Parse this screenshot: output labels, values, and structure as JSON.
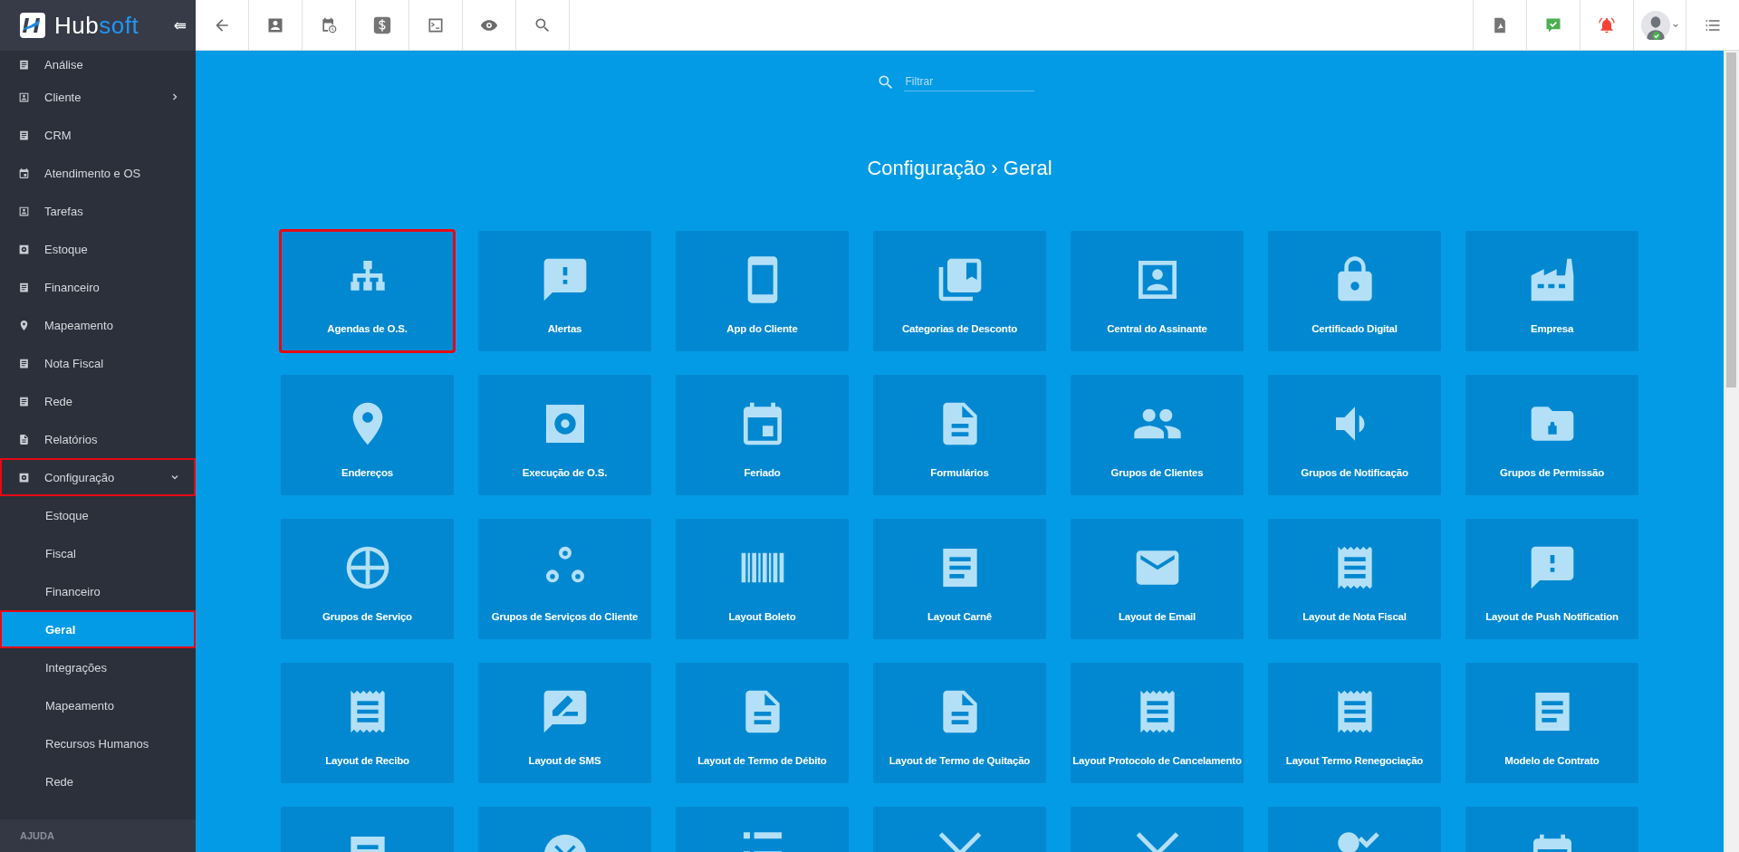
{
  "logo": {
    "text_main": "Hub",
    "text_accent": "soft"
  },
  "sidebar": {
    "items": [
      {
        "label": "Análise",
        "selected": false,
        "highlighted": false
      },
      {
        "label": "Cliente",
        "expanded": false,
        "selected": false,
        "highlighted": false
      },
      {
        "label": "CRM",
        "selected": false,
        "highlighted": false
      },
      {
        "label": "Atendimento e OS",
        "selected": false,
        "highlighted": false
      },
      {
        "label": "Tarefas",
        "selected": false,
        "highlighted": false
      },
      {
        "label": "Estoque",
        "selected": false,
        "highlighted": false
      },
      {
        "label": "Financeiro",
        "selected": false,
        "highlighted": false
      },
      {
        "label": "Mapeamento",
        "selected": false,
        "highlighted": false
      },
      {
        "label": "Nota Fiscal",
        "selected": false,
        "highlighted": false
      },
      {
        "label": "Rede",
        "selected": false,
        "highlighted": false
      },
      {
        "label": "Relatórios",
        "selected": false,
        "highlighted": false
      },
      {
        "label": "Configuração",
        "expanded": true,
        "selected": false,
        "highlighted": true,
        "children": [
          {
            "label": "Estoque",
            "selected": false,
            "highlighted": false
          },
          {
            "label": "Fiscal",
            "selected": false,
            "highlighted": false
          },
          {
            "label": "Financeiro",
            "selected": false,
            "highlighted": false
          },
          {
            "label": "Geral",
            "selected": true,
            "highlighted": true
          },
          {
            "label": "Integrações",
            "selected": false,
            "highlighted": false
          },
          {
            "label": "Mapeamento",
            "selected": false,
            "highlighted": false
          },
          {
            "label": "Recursos Humanos",
            "selected": false,
            "highlighted": false
          },
          {
            "label": "Rede",
            "selected": false,
            "highlighted": false
          }
        ]
      }
    ],
    "section": "AJUDA"
  },
  "filter": {
    "placeholder": "Filtrar"
  },
  "title": "Configuração › Geral",
  "tiles": [
    {
      "label": "Agendas de O.S.",
      "highlighted": true
    },
    {
      "label": "Alertas",
      "highlighted": false
    },
    {
      "label": "App do Cliente",
      "highlighted": false
    },
    {
      "label": "Categorias de Desconto",
      "highlighted": false
    },
    {
      "label": "Central do Assinante",
      "highlighted": false
    },
    {
      "label": "Certificado Digital",
      "highlighted": false
    },
    {
      "label": "Empresa",
      "highlighted": false
    },
    {
      "label": "Endereços",
      "highlighted": false
    },
    {
      "label": "Execução de O.S.",
      "highlighted": false
    },
    {
      "label": "Feriado",
      "highlighted": false
    },
    {
      "label": "Formulários",
      "highlighted": false
    },
    {
      "label": "Grupos de Clientes",
      "highlighted": false
    },
    {
      "label": "Grupos de Notificação",
      "highlighted": false
    },
    {
      "label": "Grupos de Permissão",
      "highlighted": false
    },
    {
      "label": "Grupos de Serviço",
      "highlighted": false
    },
    {
      "label": "Grupos de Serviços do Cliente",
      "highlighted": false
    },
    {
      "label": "Layout Boleto",
      "highlighted": false
    },
    {
      "label": "Layout Carnê",
      "highlighted": false
    },
    {
      "label": "Layout de Email",
      "highlighted": false
    },
    {
      "label": "Layout de Nota Fiscal",
      "highlighted": false
    },
    {
      "label": "Layout de Push Notification",
      "highlighted": false
    },
    {
      "label": "Layout de Recibo",
      "highlighted": false
    },
    {
      "label": "Layout de SMS",
      "highlighted": false
    },
    {
      "label": "Layout de Termo de Débito",
      "highlighted": false
    },
    {
      "label": "Layout de Termo de Quitação",
      "highlighted": false
    },
    {
      "label": "Layout Protocolo de Cancelamento",
      "highlighted": false
    },
    {
      "label": "Layout Termo Renegociação",
      "highlighted": false
    },
    {
      "label": "Modelo de Contrato",
      "highlighted": false
    },
    {
      "highlighted": false
    },
    {
      "highlighted": false
    },
    {
      "highlighted": false
    },
    {
      "highlighted": false
    },
    {
      "highlighted": false
    },
    {
      "highlighted": false
    },
    {
      "highlighted": false
    }
  ]
}
